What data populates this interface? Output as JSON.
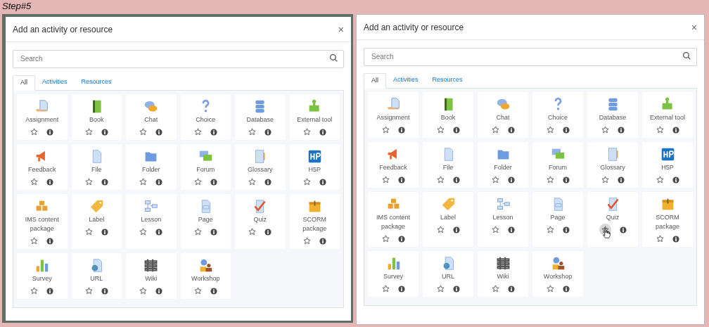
{
  "step_label": "Step#5",
  "dialogs": [
    {
      "title": "Add an activity or resource",
      "close": "×",
      "search": {
        "placeholder": "Search"
      },
      "tabs": [
        {
          "label": "All",
          "selected": true
        },
        {
          "label": "Activities",
          "selected": false
        },
        {
          "label": "Resources",
          "selected": false
        }
      ],
      "items": [
        {
          "kind": "assignment",
          "label": "Assignment",
          "star_hovered": false
        },
        {
          "kind": "book",
          "label": "Book",
          "star_hovered": false
        },
        {
          "kind": "chat",
          "label": "Chat",
          "star_hovered": false
        },
        {
          "kind": "choice",
          "label": "Choice",
          "star_hovered": false
        },
        {
          "kind": "database",
          "label": "Database",
          "star_hovered": false
        },
        {
          "kind": "tool",
          "label": "External tool",
          "star_hovered": false
        },
        {
          "kind": "feedback",
          "label": "Feedback",
          "star_hovered": false
        },
        {
          "kind": "file",
          "label": "File",
          "star_hovered": false
        },
        {
          "kind": "folder",
          "label": "Folder",
          "star_hovered": false
        },
        {
          "kind": "forum",
          "label": "Forum",
          "star_hovered": false
        },
        {
          "kind": "glossary",
          "label": "Glossary",
          "star_hovered": false
        },
        {
          "kind": "h5p",
          "label": "H5P",
          "star_hovered": false
        },
        {
          "kind": "ims",
          "label": "IMS content package",
          "star_hovered": false
        },
        {
          "kind": "label",
          "label": "Label",
          "star_hovered": false
        },
        {
          "kind": "lesson",
          "label": "Lesson",
          "star_hovered": false
        },
        {
          "kind": "page",
          "label": "Page",
          "star_hovered": false
        },
        {
          "kind": "quiz",
          "label": "Quiz",
          "star_hovered": false
        },
        {
          "kind": "scorm",
          "label": "SCORM package",
          "star_hovered": false
        },
        {
          "kind": "survey",
          "label": "Survey",
          "star_hovered": false
        },
        {
          "kind": "url",
          "label": "URL",
          "star_hovered": false
        },
        {
          "kind": "wiki",
          "label": "Wiki",
          "star_hovered": false
        },
        {
          "kind": "workshop",
          "label": "Workshop",
          "star_hovered": false
        }
      ]
    },
    {
      "title": "Add an activity or resource",
      "close": "×",
      "search": {
        "placeholder": "Search"
      },
      "tabs": [
        {
          "label": "All",
          "selected": true
        },
        {
          "label": "Activities",
          "selected": false
        },
        {
          "label": "Resources",
          "selected": false
        }
      ],
      "items": [
        {
          "kind": "assignment",
          "label": "Assignment",
          "star_hovered": false
        },
        {
          "kind": "book",
          "label": "Book",
          "star_hovered": false
        },
        {
          "kind": "chat",
          "label": "Chat",
          "star_hovered": false
        },
        {
          "kind": "choice",
          "label": "Choice",
          "star_hovered": false
        },
        {
          "kind": "database",
          "label": "Database",
          "star_hovered": false
        },
        {
          "kind": "tool",
          "label": "External tool",
          "star_hovered": false
        },
        {
          "kind": "feedback",
          "label": "Feedback",
          "star_hovered": false
        },
        {
          "kind": "file",
          "label": "File",
          "star_hovered": false
        },
        {
          "kind": "folder",
          "label": "Folder",
          "star_hovered": false
        },
        {
          "kind": "forum",
          "label": "Forum",
          "star_hovered": false
        },
        {
          "kind": "glossary",
          "label": "Glossary",
          "star_hovered": false
        },
        {
          "kind": "h5p",
          "label": "H5P",
          "star_hovered": false
        },
        {
          "kind": "ims",
          "label": "IMS content package",
          "star_hovered": false
        },
        {
          "kind": "label",
          "label": "Label",
          "star_hovered": false
        },
        {
          "kind": "lesson",
          "label": "Lesson",
          "star_hovered": false
        },
        {
          "kind": "page",
          "label": "Page",
          "star_hovered": false
        },
        {
          "kind": "quiz",
          "label": "Quiz",
          "star_hovered": true
        },
        {
          "kind": "scorm",
          "label": "SCORM package",
          "star_hovered": false
        },
        {
          "kind": "survey",
          "label": "Survey",
          "star_hovered": false
        },
        {
          "kind": "url",
          "label": "URL",
          "star_hovered": false
        },
        {
          "kind": "wiki",
          "label": "Wiki",
          "star_hovered": false
        },
        {
          "kind": "workshop",
          "label": "Workshop",
          "star_hovered": false
        }
      ]
    }
  ]
}
